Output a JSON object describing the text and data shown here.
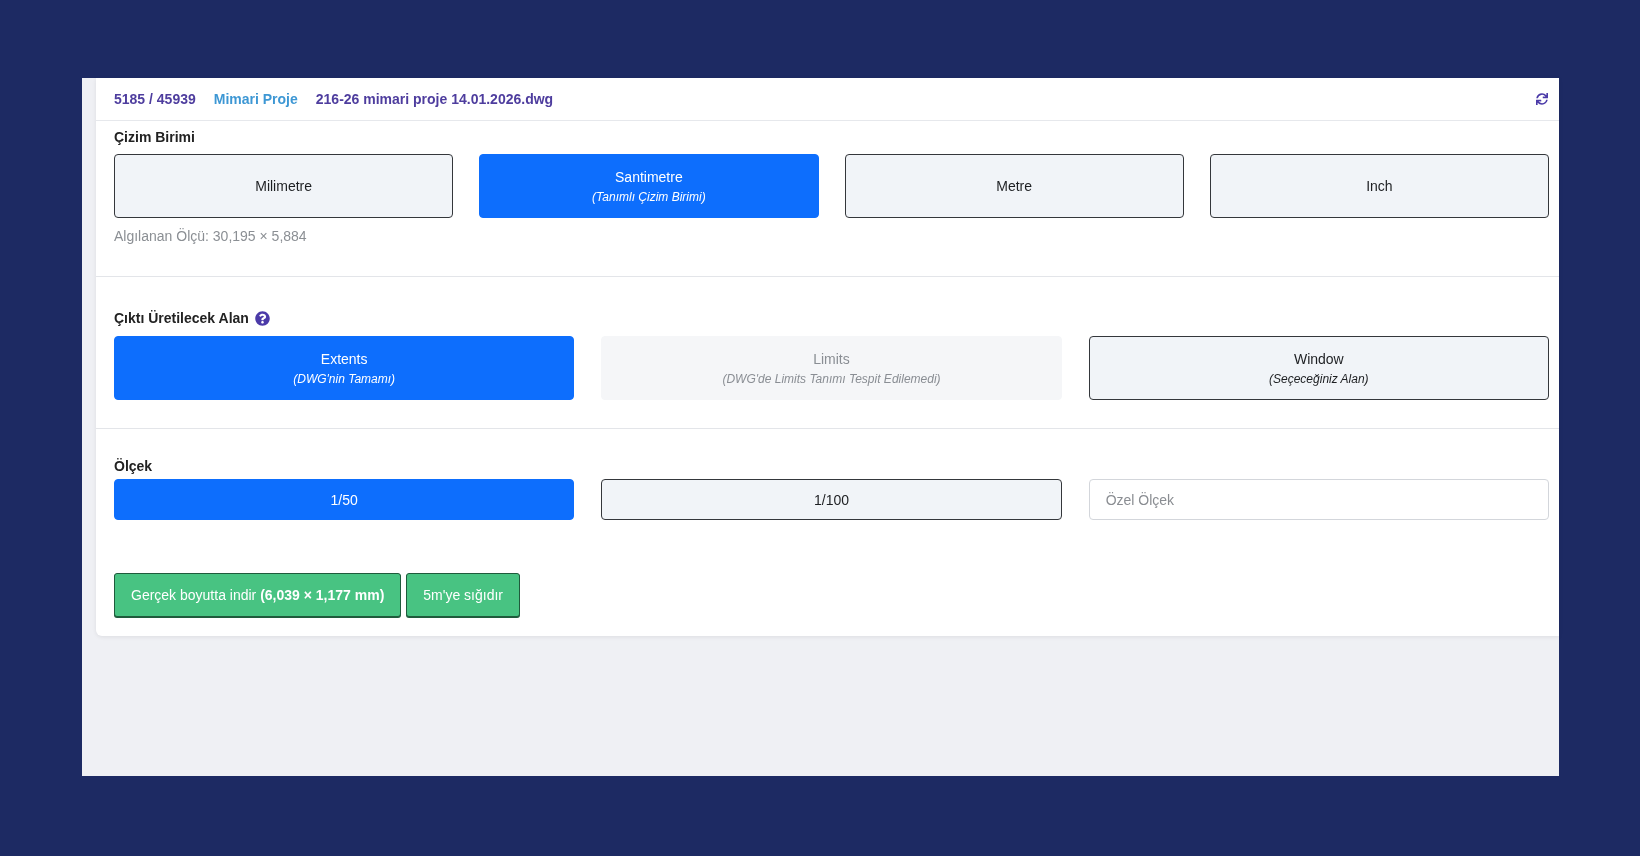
{
  "header": {
    "record_count": "5185 / 45939",
    "project": "Mimari Proje",
    "file_name": "216-26 mimari proje 14.01.2026.dwg"
  },
  "drawing_unit": {
    "label": "Çizim Birimi",
    "options": [
      {
        "label": "Milimetre",
        "selected": false
      },
      {
        "label": "Santimetre",
        "note": "(Tanımlı Çizim Birimi)",
        "selected": true
      },
      {
        "label": "Metre",
        "selected": false
      },
      {
        "label": "Inch",
        "selected": false
      }
    ],
    "detected_size": "Algılanan Ölçü: 30,195 × 5,884"
  },
  "output_area": {
    "label": "Çıktı Üretilecek Alan",
    "options": [
      {
        "label": "Extents",
        "note": "(DWG'nin Tamamı)",
        "selected": true,
        "disabled": false
      },
      {
        "label": "Limits",
        "note": "(DWG'de Limits Tanımı Tespit Edilemedi)",
        "selected": false,
        "disabled": true
      },
      {
        "label": "Window",
        "note": "(Seçeceğiniz Alan)",
        "selected": false,
        "disabled": false
      }
    ]
  },
  "scale": {
    "label": "Ölçek",
    "options": [
      {
        "label": "1/50",
        "selected": true
      },
      {
        "label": "1/100",
        "selected": false
      }
    ],
    "custom": {
      "placeholder": "Özel Ölçek"
    }
  },
  "actions": [
    {
      "text": "Gerçek boyutta indir **(6,039 × 1,177 mm)**"
    },
    {
      "text": "5m'ye sığıdır"
    }
  ]
}
